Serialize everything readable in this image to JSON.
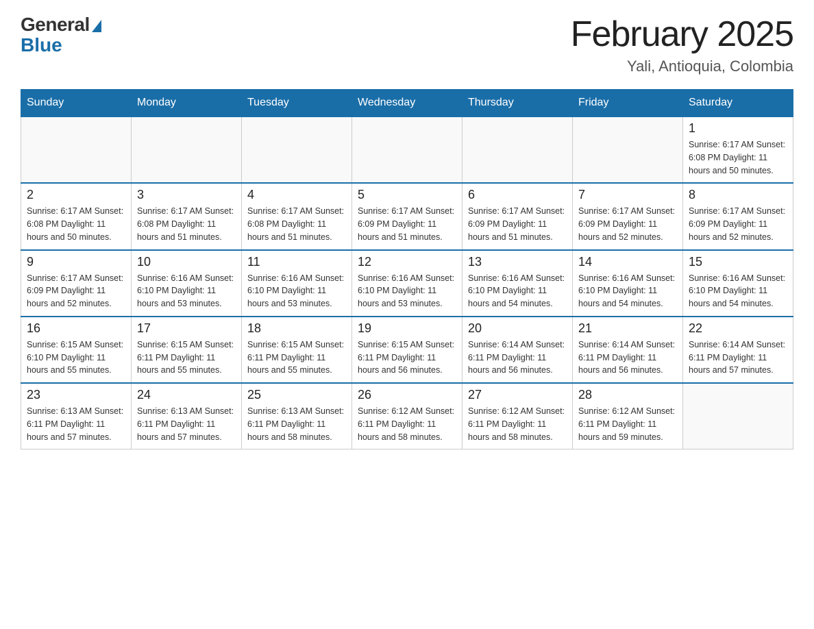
{
  "header": {
    "logo_general": "General",
    "logo_blue": "Blue",
    "month_title": "February 2025",
    "location": "Yali, Antioquia, Colombia"
  },
  "days_of_week": [
    "Sunday",
    "Monday",
    "Tuesday",
    "Wednesday",
    "Thursday",
    "Friday",
    "Saturday"
  ],
  "weeks": [
    [
      {
        "day": "",
        "info": ""
      },
      {
        "day": "",
        "info": ""
      },
      {
        "day": "",
        "info": ""
      },
      {
        "day": "",
        "info": ""
      },
      {
        "day": "",
        "info": ""
      },
      {
        "day": "",
        "info": ""
      },
      {
        "day": "1",
        "info": "Sunrise: 6:17 AM\nSunset: 6:08 PM\nDaylight: 11 hours and 50 minutes."
      }
    ],
    [
      {
        "day": "2",
        "info": "Sunrise: 6:17 AM\nSunset: 6:08 PM\nDaylight: 11 hours and 50 minutes."
      },
      {
        "day": "3",
        "info": "Sunrise: 6:17 AM\nSunset: 6:08 PM\nDaylight: 11 hours and 51 minutes."
      },
      {
        "day": "4",
        "info": "Sunrise: 6:17 AM\nSunset: 6:08 PM\nDaylight: 11 hours and 51 minutes."
      },
      {
        "day": "5",
        "info": "Sunrise: 6:17 AM\nSunset: 6:09 PM\nDaylight: 11 hours and 51 minutes."
      },
      {
        "day": "6",
        "info": "Sunrise: 6:17 AM\nSunset: 6:09 PM\nDaylight: 11 hours and 51 minutes."
      },
      {
        "day": "7",
        "info": "Sunrise: 6:17 AM\nSunset: 6:09 PM\nDaylight: 11 hours and 52 minutes."
      },
      {
        "day": "8",
        "info": "Sunrise: 6:17 AM\nSunset: 6:09 PM\nDaylight: 11 hours and 52 minutes."
      }
    ],
    [
      {
        "day": "9",
        "info": "Sunrise: 6:17 AM\nSunset: 6:09 PM\nDaylight: 11 hours and 52 minutes."
      },
      {
        "day": "10",
        "info": "Sunrise: 6:16 AM\nSunset: 6:10 PM\nDaylight: 11 hours and 53 minutes."
      },
      {
        "day": "11",
        "info": "Sunrise: 6:16 AM\nSunset: 6:10 PM\nDaylight: 11 hours and 53 minutes."
      },
      {
        "day": "12",
        "info": "Sunrise: 6:16 AM\nSunset: 6:10 PM\nDaylight: 11 hours and 53 minutes."
      },
      {
        "day": "13",
        "info": "Sunrise: 6:16 AM\nSunset: 6:10 PM\nDaylight: 11 hours and 54 minutes."
      },
      {
        "day": "14",
        "info": "Sunrise: 6:16 AM\nSunset: 6:10 PM\nDaylight: 11 hours and 54 minutes."
      },
      {
        "day": "15",
        "info": "Sunrise: 6:16 AM\nSunset: 6:10 PM\nDaylight: 11 hours and 54 minutes."
      }
    ],
    [
      {
        "day": "16",
        "info": "Sunrise: 6:15 AM\nSunset: 6:10 PM\nDaylight: 11 hours and 55 minutes."
      },
      {
        "day": "17",
        "info": "Sunrise: 6:15 AM\nSunset: 6:11 PM\nDaylight: 11 hours and 55 minutes."
      },
      {
        "day": "18",
        "info": "Sunrise: 6:15 AM\nSunset: 6:11 PM\nDaylight: 11 hours and 55 minutes."
      },
      {
        "day": "19",
        "info": "Sunrise: 6:15 AM\nSunset: 6:11 PM\nDaylight: 11 hours and 56 minutes."
      },
      {
        "day": "20",
        "info": "Sunrise: 6:14 AM\nSunset: 6:11 PM\nDaylight: 11 hours and 56 minutes."
      },
      {
        "day": "21",
        "info": "Sunrise: 6:14 AM\nSunset: 6:11 PM\nDaylight: 11 hours and 56 minutes."
      },
      {
        "day": "22",
        "info": "Sunrise: 6:14 AM\nSunset: 6:11 PM\nDaylight: 11 hours and 57 minutes."
      }
    ],
    [
      {
        "day": "23",
        "info": "Sunrise: 6:13 AM\nSunset: 6:11 PM\nDaylight: 11 hours and 57 minutes."
      },
      {
        "day": "24",
        "info": "Sunrise: 6:13 AM\nSunset: 6:11 PM\nDaylight: 11 hours and 57 minutes."
      },
      {
        "day": "25",
        "info": "Sunrise: 6:13 AM\nSunset: 6:11 PM\nDaylight: 11 hours and 58 minutes."
      },
      {
        "day": "26",
        "info": "Sunrise: 6:12 AM\nSunset: 6:11 PM\nDaylight: 11 hours and 58 minutes."
      },
      {
        "day": "27",
        "info": "Sunrise: 6:12 AM\nSunset: 6:11 PM\nDaylight: 11 hours and 58 minutes."
      },
      {
        "day": "28",
        "info": "Sunrise: 6:12 AM\nSunset: 6:11 PM\nDaylight: 11 hours and 59 minutes."
      },
      {
        "day": "",
        "info": ""
      }
    ]
  ]
}
